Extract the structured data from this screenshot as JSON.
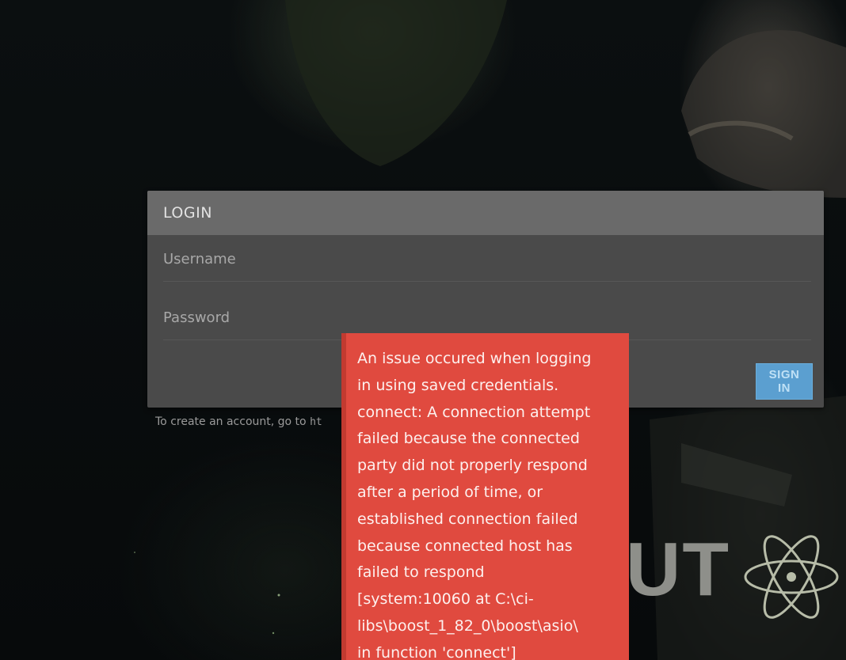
{
  "login": {
    "title": "LOGIN",
    "username_placeholder": "Username",
    "password_placeholder": "Password",
    "signin_label": "SIGN IN"
  },
  "account_note": {
    "text": "To create an account, go to ",
    "link_fragment": "ht"
  },
  "brand": {
    "logo_text": "UT",
    "icon": "atom-icon"
  },
  "error": {
    "message": "An issue occured when logging\nin using saved credentials.\nconnect: A connection attempt\nfailed because the connected\nparty did not properly respond\nafter a period of time, or\nestablished connection failed\nbecause connected host has\nfailed to respond\n[system:10060 at C:\\ci-\nlibs\\boost_1_82_0\\boost\\asio\\\nin function 'connect']"
  },
  "colors": {
    "error_background": "#e04a3f",
    "signin_button": "#5b9fd0",
    "panel_header": "#6a6a6a",
    "panel_body": "#4a4a4a"
  }
}
